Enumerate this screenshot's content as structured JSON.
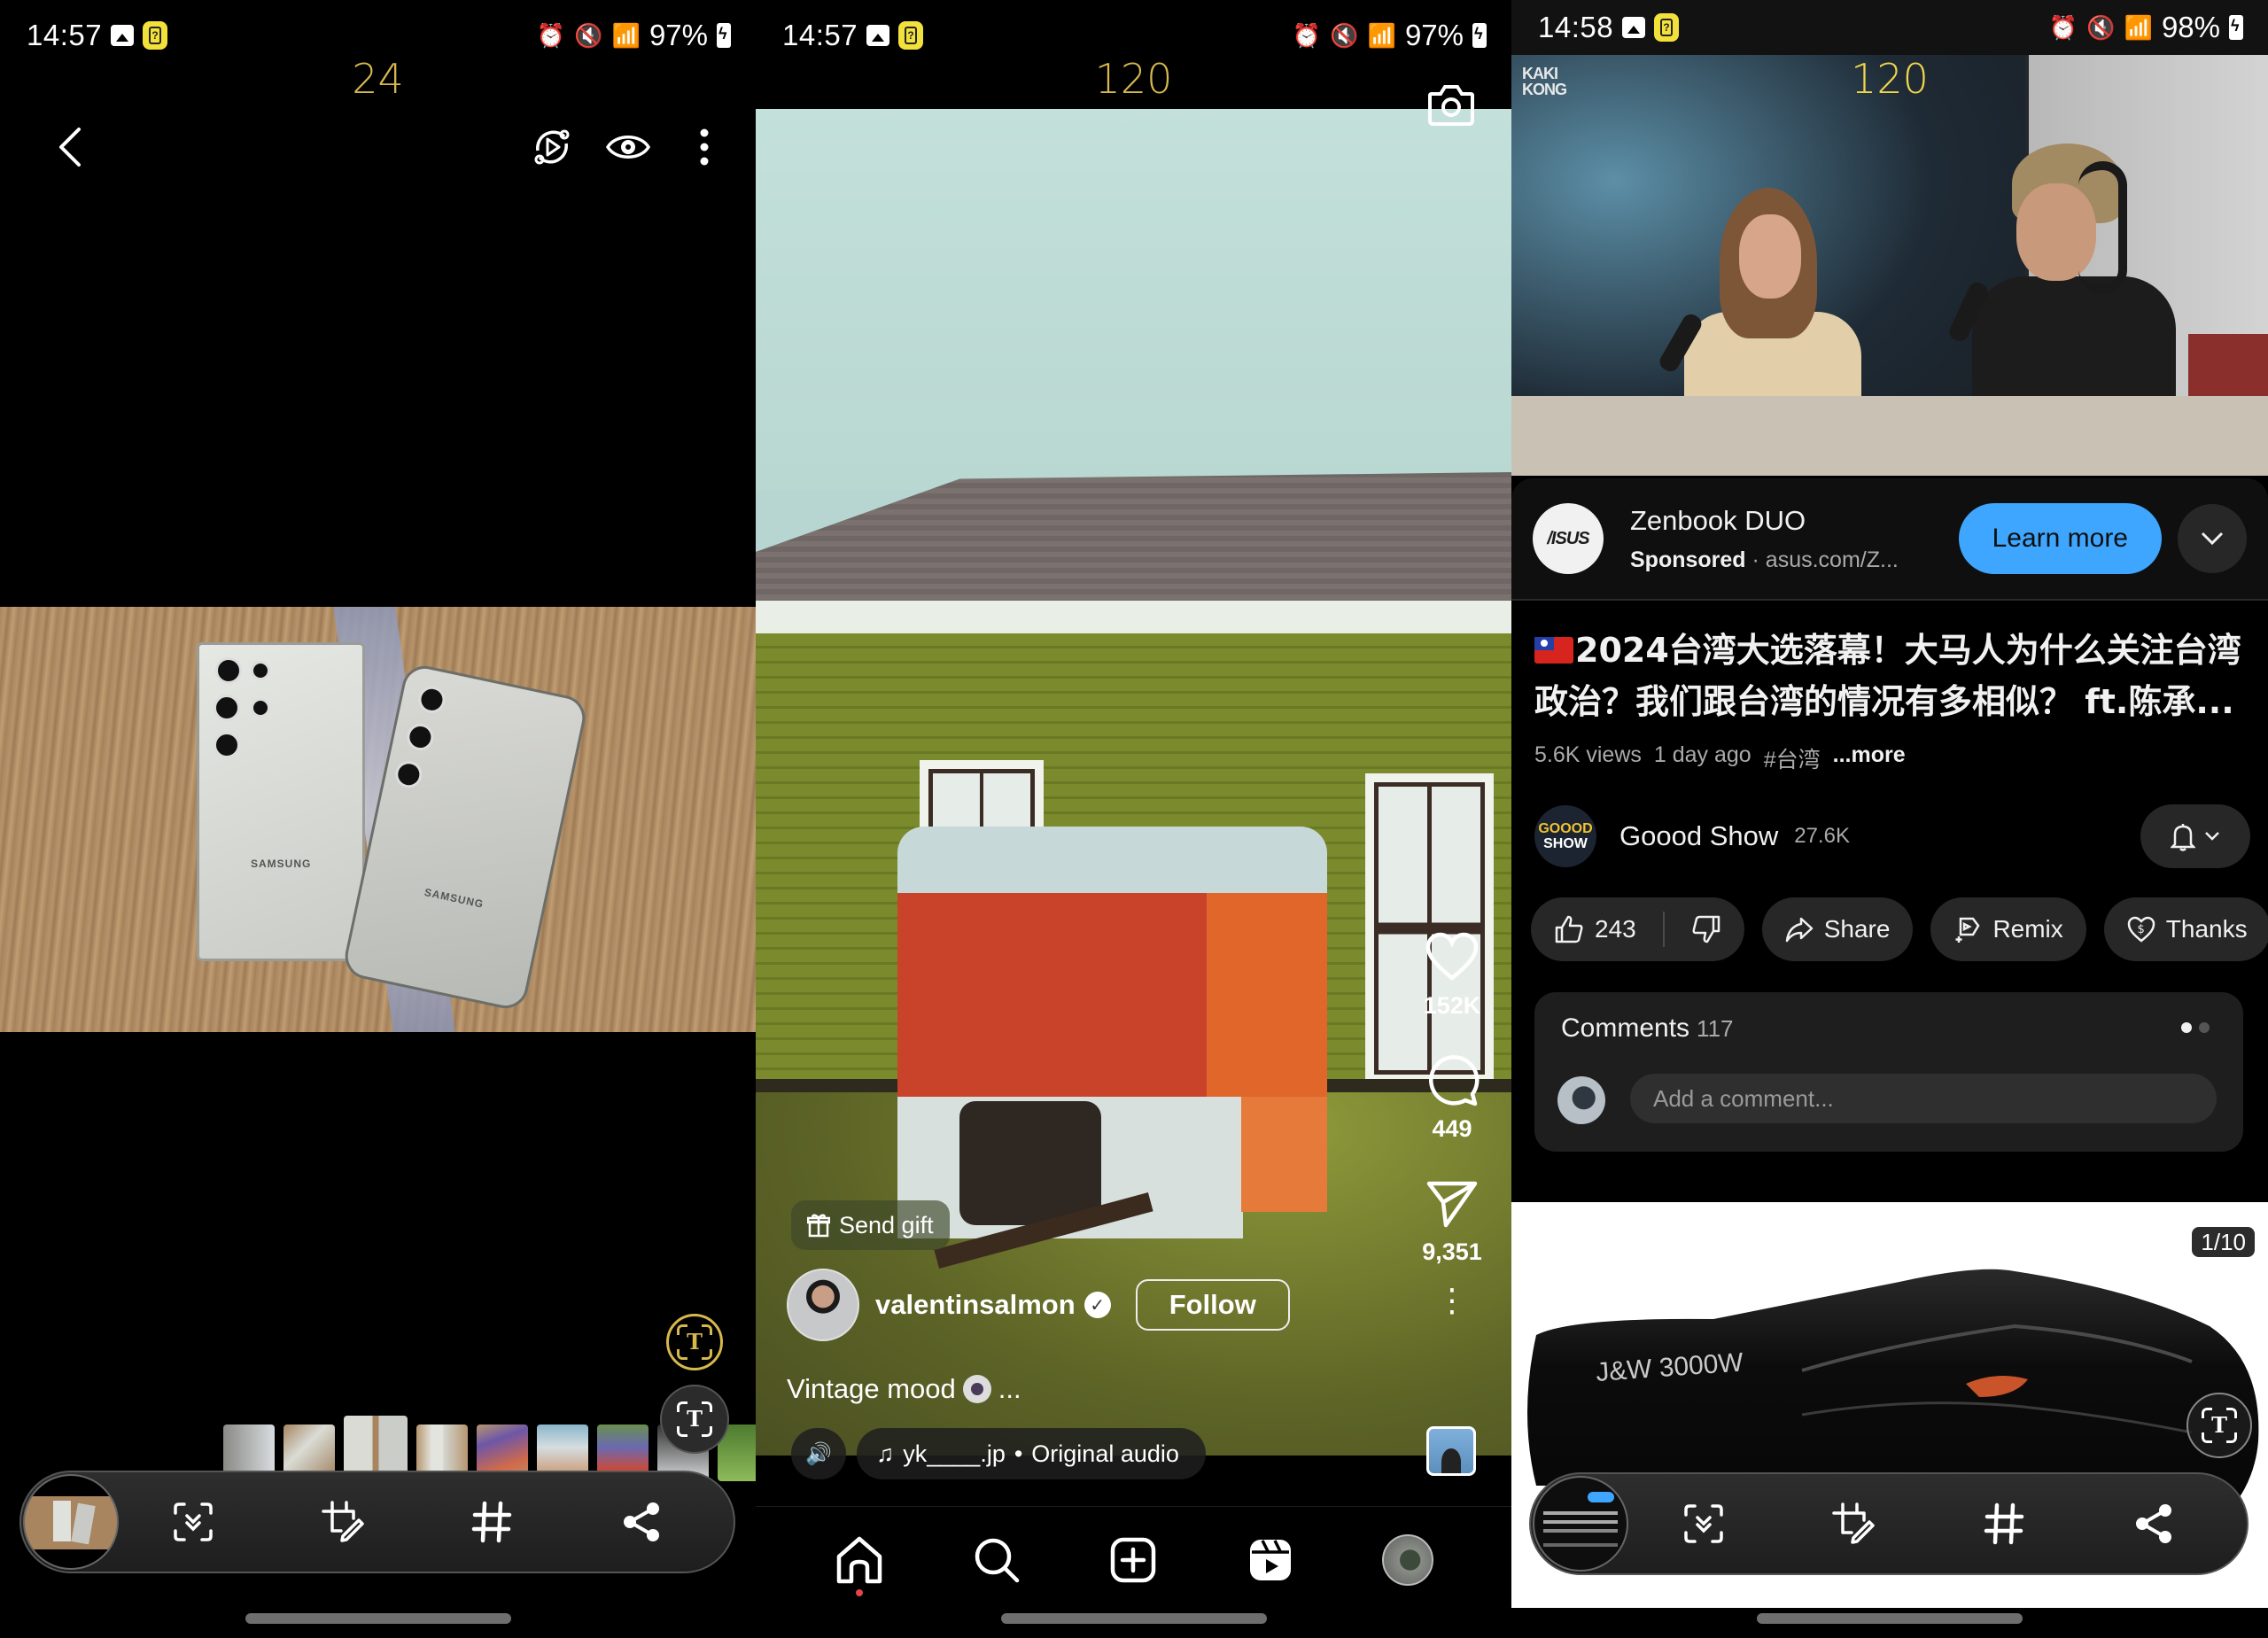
{
  "panels": [
    {
      "id": "gallery",
      "status": {
        "time": "14:57",
        "battery": "97%",
        "icons": [
          "image-icon",
          "help-device-icon",
          "alarm-icon",
          "mute-icon",
          "wifi6-icon",
          "wifi-calling-icon",
          "signal-icon",
          "battery-charging-icon"
        ]
      },
      "counter": "24",
      "toolbar": {
        "back": "back-icon",
        "actions": [
          "motion-photo-icon",
          "view-icon",
          "more-options-icon"
        ]
      },
      "photo": {
        "brand_left": "SAMSUNG",
        "brand_right": "SAMSUNG"
      },
      "text_extract_label": "T",
      "thumbnails_count": 9,
      "action_bar": {
        "items": [
          "scan-icon",
          "crop-edit-icon",
          "hashtag-icon",
          "share-icon"
        ]
      }
    },
    {
      "id": "instagram-reel",
      "status": {
        "time": "14:57",
        "battery": "97%"
      },
      "counter": "120",
      "send_gift": "Send gift",
      "author": {
        "username": "valentinsalmon",
        "verified": true,
        "follow_label": "Follow"
      },
      "caption": "Vintage mood",
      "caption_more": "...",
      "audio": {
        "artist": "yk____.jp",
        "separator": "•",
        "title": "Original audio"
      },
      "stats": {
        "likes": "152K",
        "comments": "449",
        "shares": "9,351"
      },
      "nav": [
        "home-icon",
        "search-icon",
        "create-icon",
        "reels-icon",
        "profile-avatar"
      ]
    },
    {
      "id": "youtube",
      "status": {
        "time": "14:58",
        "battery": "98%"
      },
      "counter": "120",
      "video_logo": "KAKI KONG",
      "ad": {
        "logo_text": "/ISUS",
        "title": "Zenbook DUO",
        "sponsored": "Sponsored",
        "url": "asus.com/Z...",
        "cta": "Learn more"
      },
      "video": {
        "title": "2024台湾大选落幕！大马人为什么关注台湾政治？我们跟台湾的情况有多相似？ ft.陈承...",
        "views": "5.6K views",
        "age": "1 day ago",
        "hashtag": "#台湾",
        "more": "...more"
      },
      "channel": {
        "logo_line1": "GOOOD",
        "logo_line2": "SHOW",
        "name": "Goood Show",
        "subscribers": "27.6K"
      },
      "actions": {
        "likes": "243",
        "share": "Share",
        "remix": "Remix",
        "thanks": "Thanks"
      },
      "comments": {
        "label": "Comments",
        "count": "117",
        "placeholder": "Add a comment..."
      },
      "product": {
        "label": "J&W 3000W",
        "page": "1/10"
      },
      "text_extract_label": "T",
      "action_bar": {
        "items": [
          "scan-icon",
          "crop-edit-icon",
          "hashtag-icon",
          "share-icon"
        ]
      }
    }
  ]
}
